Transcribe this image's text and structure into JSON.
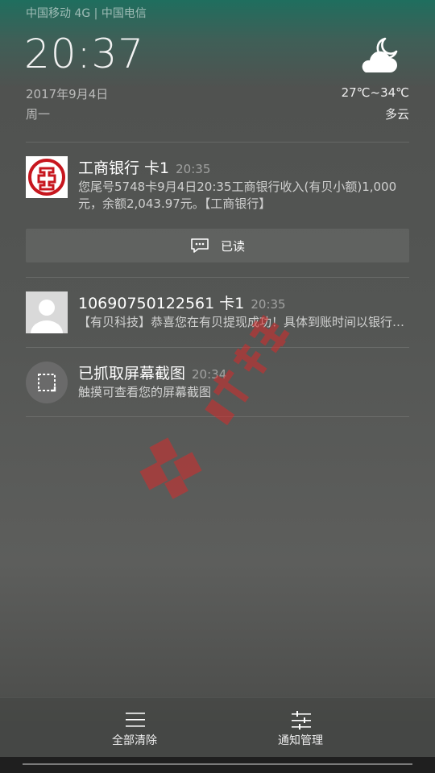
{
  "status_bar": {
    "carrier_text": "中国移动 4G | 中国电信"
  },
  "lockscreen": {
    "time": "20:37",
    "date": "2017年9月4日",
    "weekday": "周一",
    "weather": {
      "icon": "cloud-moon-icon",
      "temperature": "27℃~34℃",
      "condition": "多云"
    }
  },
  "notifications": [
    {
      "app_icon": "icbc-logo-icon",
      "title": "工商银行 卡1",
      "time": "20:35",
      "body": "您尾号5748卡9月4日20:35工商银行收入(有贝小额)1,000元，余额2,043.97元。【工商银行】",
      "action_label": "已读",
      "action_icon": "message-read-icon"
    },
    {
      "app_icon": "contact-avatar-icon",
      "title": "10690750122561 卡1",
      "time": "20:35",
      "body": "【有贝科技】恭喜您在有贝提现成功！具体到账时间以银行为准"
    },
    {
      "app_icon": "screenshot-icon",
      "title": "已抓取屏幕截图",
      "time": "20:34",
      "body": "触摸可查看您的屏幕截图"
    }
  ],
  "bottom_actions": {
    "clear_all": {
      "label": "全部清除",
      "icon": "clear-all-icon"
    },
    "manage": {
      "label": "通知管理",
      "icon": "sliders-icon"
    }
  },
  "colors": {
    "icbc_red": "#c7161e",
    "avatar_gray": "#d9d9d9",
    "watermark_red": "#d62b2b"
  }
}
